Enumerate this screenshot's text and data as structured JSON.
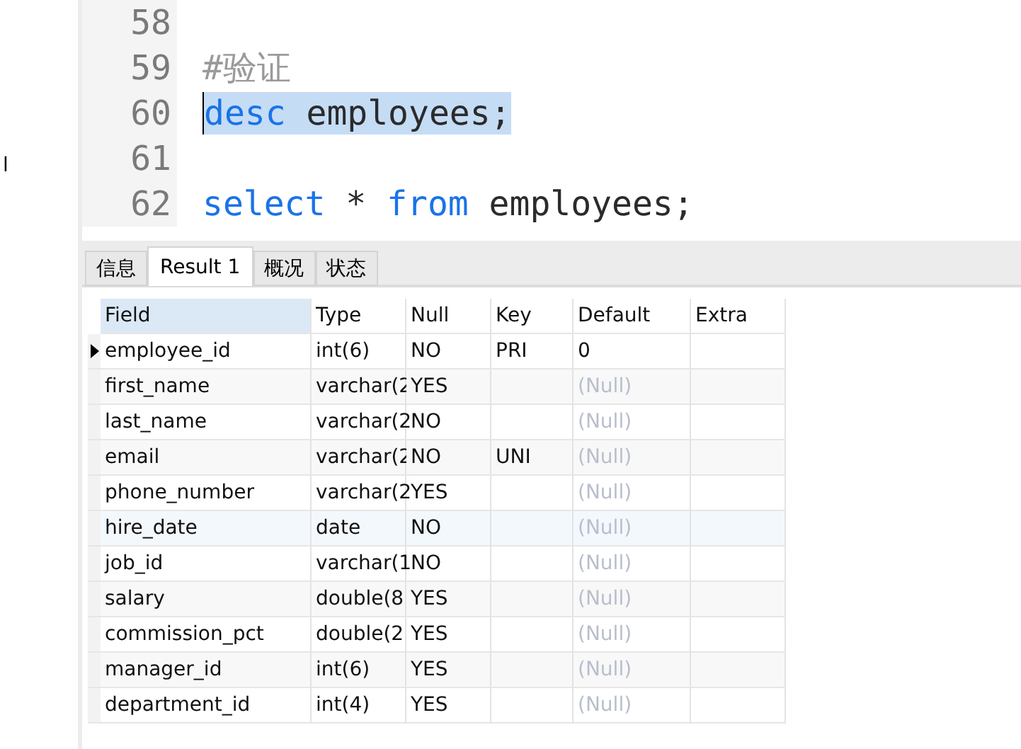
{
  "sidebar": {
    "items": [
      "l"
    ]
  },
  "editor": {
    "lines": [
      {
        "number": "58",
        "selected": false
      },
      {
        "number": "59",
        "selected": false,
        "tokens": [
          {
            "kind": "comment",
            "text": "#验证"
          }
        ]
      },
      {
        "number": "60",
        "selected": true,
        "tokens": [
          {
            "kind": "keyword",
            "text": "desc"
          },
          {
            "kind": "plain",
            "text": " employees;"
          }
        ]
      },
      {
        "number": "61",
        "selected": false
      },
      {
        "number": "62",
        "selected": false,
        "tokens": [
          {
            "kind": "keyword",
            "text": "select"
          },
          {
            "kind": "plain",
            "text": " * "
          },
          {
            "kind": "keyword",
            "text": "from"
          },
          {
            "kind": "plain",
            "text": " employees;"
          }
        ]
      }
    ]
  },
  "tabs": [
    {
      "label": "信息",
      "selected": false
    },
    {
      "label": "Result 1",
      "selected": true
    },
    {
      "label": "概况",
      "selected": false
    },
    {
      "label": "状态",
      "selected": false
    }
  ],
  "table": {
    "columns": [
      {
        "label": "Field",
        "selected": true
      },
      {
        "label": "Type",
        "selected": false
      },
      {
        "label": "Null",
        "selected": false
      },
      {
        "label": "Key",
        "selected": false
      },
      {
        "label": "Default",
        "selected": false
      },
      {
        "label": "Extra",
        "selected": false
      }
    ],
    "rows": [
      {
        "selected": true,
        "highlighted": false,
        "cells": [
          "employee_id",
          "int(6)",
          "NO",
          "PRI",
          "0",
          ""
        ],
        "default_null": false
      },
      {
        "selected": false,
        "highlighted": false,
        "cells": [
          "first_name",
          "varchar(2",
          "YES",
          "",
          "(Null)",
          ""
        ],
        "default_null": true
      },
      {
        "selected": false,
        "highlighted": false,
        "cells": [
          "last_name",
          "varchar(2",
          "NO",
          "",
          "(Null)",
          ""
        ],
        "default_null": true
      },
      {
        "selected": false,
        "highlighted": false,
        "cells": [
          "email",
          "varchar(2",
          "NO",
          "UNI",
          "(Null)",
          ""
        ],
        "default_null": true
      },
      {
        "selected": false,
        "highlighted": false,
        "cells": [
          "phone_number",
          "varchar(2",
          "YES",
          "",
          "(Null)",
          ""
        ],
        "default_null": true
      },
      {
        "selected": false,
        "highlighted": true,
        "cells": [
          "hire_date",
          "date",
          "NO",
          "",
          "(Null)",
          ""
        ],
        "default_null": true
      },
      {
        "selected": false,
        "highlighted": false,
        "cells": [
          "job_id",
          "varchar(1",
          "NO",
          "",
          "(Null)",
          ""
        ],
        "default_null": true
      },
      {
        "selected": false,
        "highlighted": false,
        "cells": [
          "salary",
          "double(8",
          "YES",
          "",
          "(Null)",
          ""
        ],
        "default_null": true
      },
      {
        "selected": false,
        "highlighted": false,
        "cells": [
          "commission_pct",
          "double(2",
          "YES",
          "",
          "(Null)",
          ""
        ],
        "default_null": true
      },
      {
        "selected": false,
        "highlighted": false,
        "cells": [
          "manager_id",
          "int(6)",
          "YES",
          "",
          "(Null)",
          ""
        ],
        "default_null": true
      },
      {
        "selected": false,
        "highlighted": false,
        "cells": [
          "department_id",
          "int(4)",
          "YES",
          "",
          "(Null)",
          ""
        ],
        "default_null": true
      }
    ]
  }
}
